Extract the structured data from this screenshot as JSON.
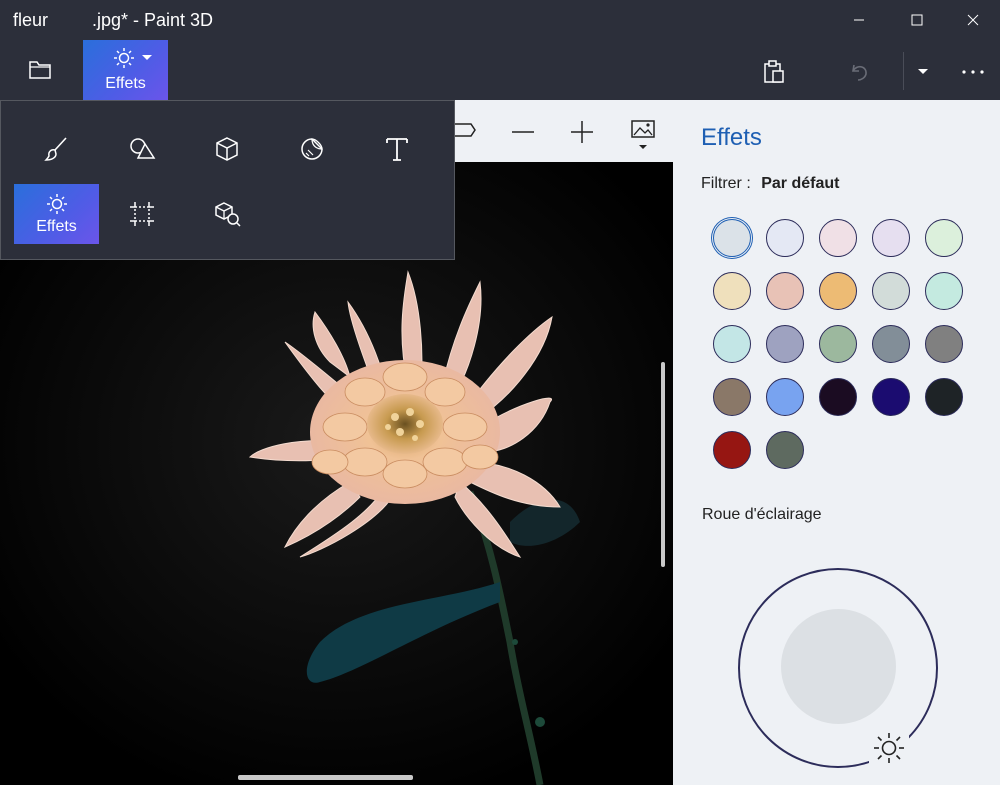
{
  "window": {
    "file_name": "fleur",
    "title_rest": ".jpg* - Paint 3D",
    "minimize_icon": "minimize-icon",
    "maximize_icon": "maximize-icon",
    "close_icon": "close-icon"
  },
  "toolbar": {
    "open_icon": "folder-icon",
    "effects_label": "Effets",
    "paste_icon": "paste-icon",
    "undo_icon": "undo-icon",
    "history_icon": "chevron-down-icon",
    "more_icon": "more-icon"
  },
  "canvas_tools": {
    "icons": [
      "shape-tail-icon",
      "zoom-out-icon",
      "zoom-in-icon",
      "image-options-icon"
    ]
  },
  "flyout": {
    "items": [
      {
        "icon": "brush-icon"
      },
      {
        "icon": "2d-shapes-icon"
      },
      {
        "icon": "3d-shapes-icon"
      },
      {
        "icon": "stickers-icon"
      },
      {
        "icon": "text-icon"
      },
      {
        "icon": "effects-icon",
        "label": "Effets",
        "active": true
      },
      {
        "icon": "canvas-icon"
      },
      {
        "icon": "3d-library-icon"
      }
    ]
  },
  "panel": {
    "title": "Effets",
    "filter_label": "Filtrer :",
    "filter_value": "Par défaut",
    "swatches": [
      "#dbe2e8",
      "#e4e8f4",
      "#f0e0e6",
      "#e6dff0",
      "#dcf0dc",
      "#efe0bc",
      "#e8c2b6",
      "#edbb74",
      "#d2dcd9",
      "#c4eae0",
      "#c3e6e6",
      "#9ea2c0",
      "#9cb89e",
      "#828e98",
      "#808080",
      "#8a7868",
      "#78a3f0",
      "#1b0c22",
      "#1b0c70",
      "#1e2326",
      "#961612",
      "#5e6a60"
    ],
    "wheel_label": "Roue d'éclairage",
    "wheel_handle_icon": "sun-icon"
  }
}
